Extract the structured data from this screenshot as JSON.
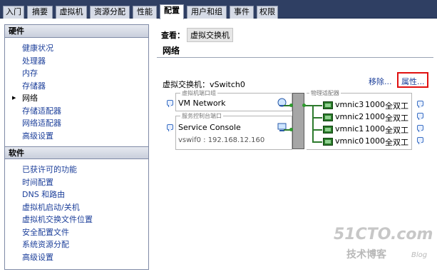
{
  "tabs": [
    {
      "label": "入门",
      "active": false
    },
    {
      "label": "摘要",
      "active": false
    },
    {
      "label": "虚拟机",
      "active": false
    },
    {
      "label": "资源分配",
      "active": false
    },
    {
      "label": "性能",
      "active": false
    },
    {
      "label": "配置",
      "active": true
    },
    {
      "label": "用户和组",
      "active": false
    },
    {
      "label": "事件",
      "active": false
    },
    {
      "label": "权限",
      "active": false
    }
  ],
  "sidebar": {
    "hardware": {
      "title": "硬件",
      "items": [
        "健康状况",
        "处理器",
        "内存",
        "存储器",
        "网络",
        "存储适配器",
        "网络适配器",
        "高级设置"
      ],
      "selected": "网络"
    },
    "software": {
      "title": "软件",
      "items": [
        "已获许可的功能",
        "时间配置",
        "DNS 和路由",
        "虚拟机启动/关机",
        "虚拟机交换文件位置",
        "安全配置文件",
        "系统资源分配",
        "高级设置"
      ]
    }
  },
  "main": {
    "view_label": "查看：",
    "view_value": "虚拟交换机",
    "heading": "网络",
    "switch_label": "虚拟交换机：",
    "switch_name": "vSwitch0",
    "remove_link": "移除...",
    "properties_link": "属性...",
    "vm_port_group": {
      "title": "虚拟机端口组",
      "name": "VM Network"
    },
    "console_port": {
      "title": "服务控制台端口",
      "name": "Service Console",
      "ip": "vswif0 : 192.168.12.160"
    },
    "adapters": {
      "title": "物理适配器",
      "items": [
        {
          "name": "vmnic3",
          "speed": "1000",
          "duplex": "全双工"
        },
        {
          "name": "vmnic2",
          "speed": "1000",
          "duplex": "全双工"
        },
        {
          "name": "vmnic1",
          "speed": "1000",
          "duplex": "全双工"
        },
        {
          "name": "vmnic0",
          "speed": "1000",
          "duplex": "全双工"
        }
      ]
    }
  },
  "watermark": {
    "logo": "51CTO.com",
    "sub": "技术博客",
    "blog": "Blog"
  },
  "colors": {
    "tabbar": "#2f3f63",
    "link": "#1c3f9a",
    "highlight_box": "#e01010",
    "connector_green": "#2d7a2d"
  }
}
